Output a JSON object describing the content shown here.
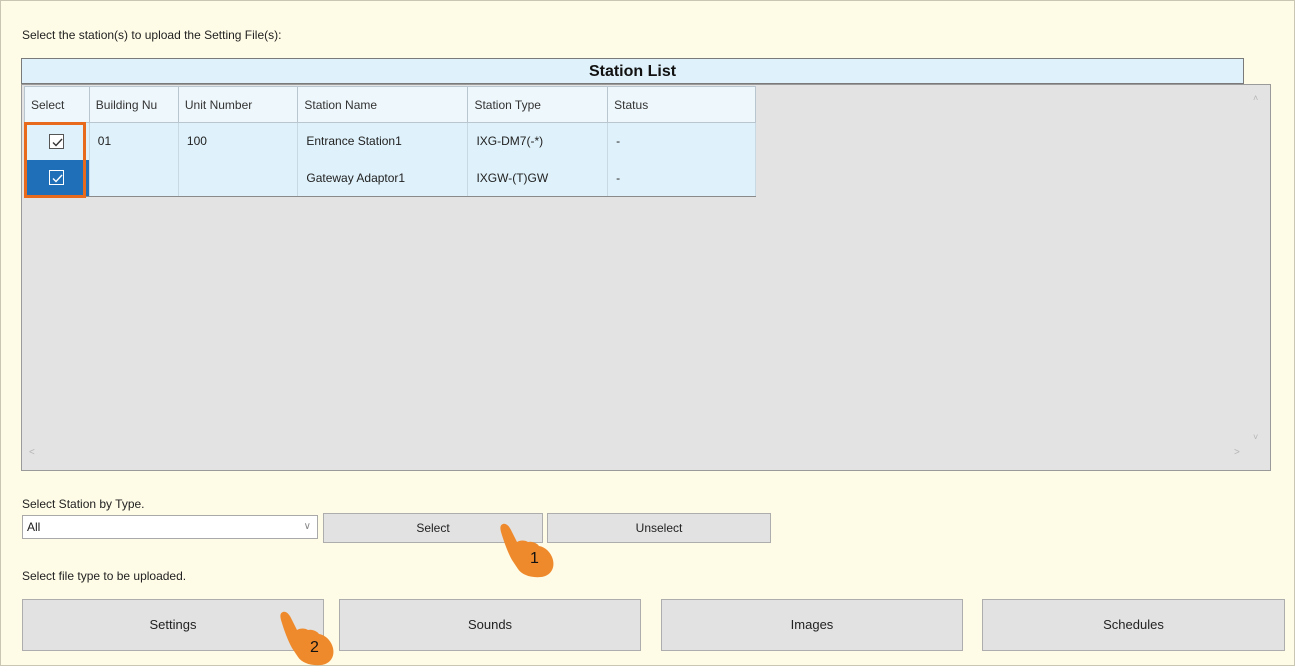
{
  "instructions": {
    "select_stations": "Select the station(s) to upload the Setting File(s):",
    "select_by_type": "Select Station by Type.",
    "select_file_type": "Select file type to be uploaded."
  },
  "station_list": {
    "title": "Station List",
    "columns": [
      "Select",
      "Building Nu",
      "Unit Number",
      "Station Name",
      "Station Type",
      "Status"
    ],
    "rows": [
      {
        "selected": true,
        "building": "01",
        "unit": "100",
        "name": "Entrance Station1",
        "type": "IXG-DM7(-*)",
        "status": "-"
      },
      {
        "selected": true,
        "building": "",
        "unit": "",
        "name": "Gateway Adaptor1",
        "type": "IXGW-(T)GW",
        "status": "-"
      }
    ]
  },
  "type_filter": {
    "value": "All",
    "select_label": "Select",
    "unselect_label": "Unselect"
  },
  "file_types": {
    "settings_label": "Settings",
    "sounds_label": "Sounds",
    "images_label": "Images",
    "schedules_label": "Schedules"
  },
  "annotations": {
    "step1": "1",
    "step2": "2",
    "accent_color": "#e86a1c"
  },
  "icons": {
    "pointer": "hand-pointer-icon",
    "checkbox": "checkmark-icon",
    "dropdown": "chevron-down-icon"
  }
}
